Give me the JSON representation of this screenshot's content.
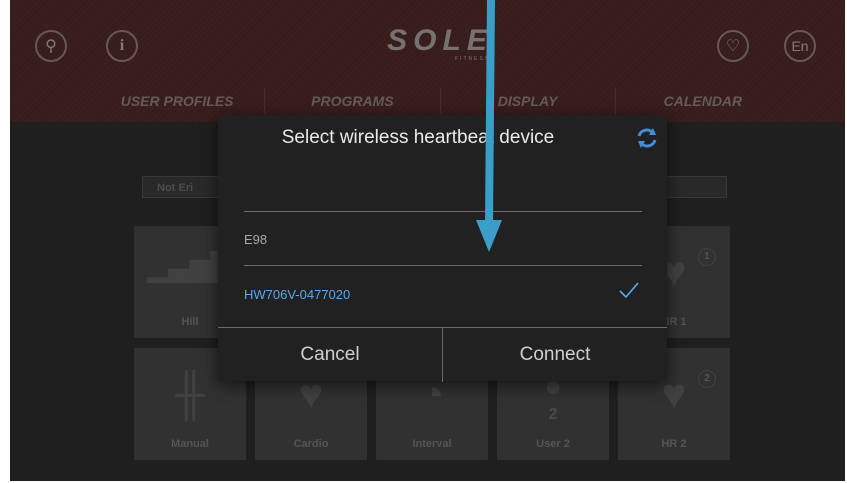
{
  "header": {
    "logo_text": "SOLE",
    "logo_sub": "FITNESS",
    "info_label": "i",
    "lang_label": "En",
    "nav": [
      "USER PROFILES",
      "PROGRAMS",
      "DISPLAY",
      "CALENDAR"
    ]
  },
  "background": {
    "filter_pill": "Not Eri",
    "tiles_row1": [
      "Hill",
      "",
      "",
      "",
      "HR 1"
    ],
    "tiles_row2": [
      "Manual",
      "Cardio",
      "Interval",
      "User 2",
      "HR 2"
    ],
    "user2_badge": "2",
    "hr1_badge": "1",
    "hr2_badge": "2"
  },
  "dialog": {
    "title": "Select wireless heartbeat device",
    "devices": [
      {
        "name": "E98",
        "selected": false
      },
      {
        "name": "HW706V-0477020",
        "selected": true
      }
    ],
    "cancel_label": "Cancel",
    "connect_label": "Connect"
  },
  "colors": {
    "accent": "#3f8fe0",
    "selected_text": "#5aa8ef",
    "annotation_arrow": "#3a9ec9"
  }
}
